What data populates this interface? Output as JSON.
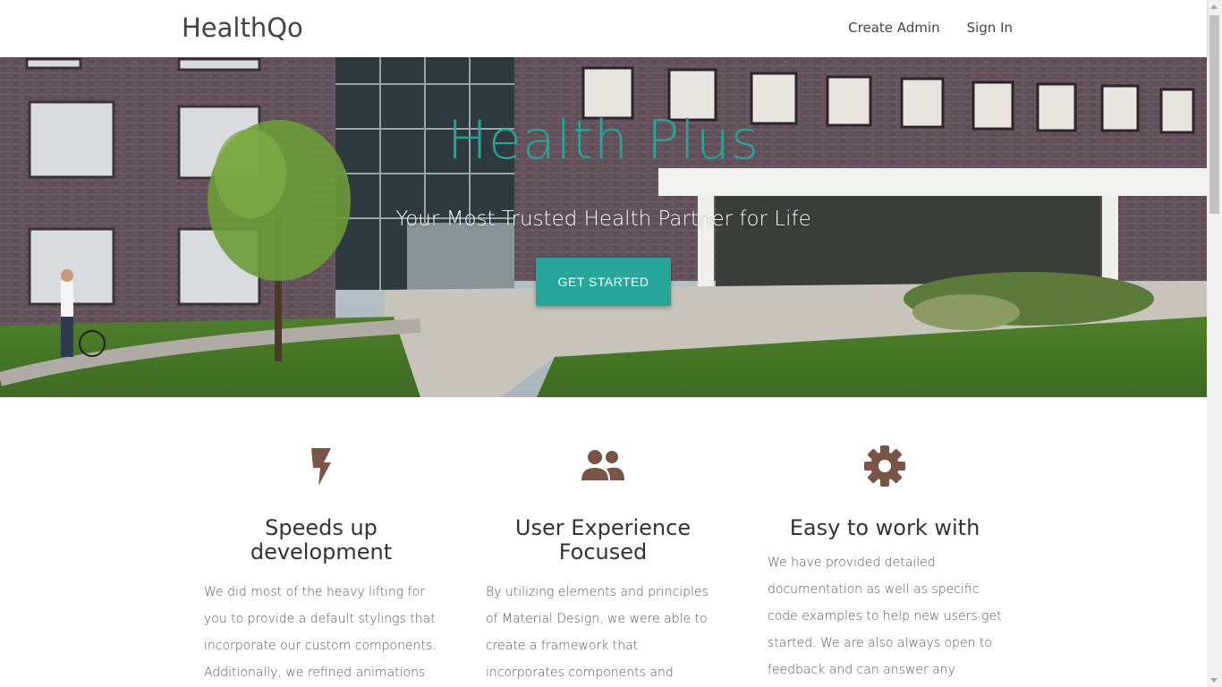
{
  "navbar": {
    "brand": "HealthQo",
    "links": [
      {
        "label": "Create Admin"
      },
      {
        "label": "Sign In"
      }
    ]
  },
  "hero": {
    "title": "Health Plus",
    "subtitle": "Your Most Trusted Health Partner for Life",
    "cta_label": "GET STARTED",
    "accent_color": "#26a69a"
  },
  "features": [
    {
      "icon": "flash-icon",
      "title": "Speeds up development",
      "text": "We did most of the heavy lifting for you to provide a default stylings that incorporate our custom components. Additionally, we refined animations and"
    },
    {
      "icon": "group-icon",
      "title": "User Experience Focused",
      "text": "By utilizing elements and principles of Material Design, we were able to create a framework that incorporates components and animations that provide more"
    },
    {
      "icon": "settings-icon",
      "title": "Easy to work with",
      "text": "We have provided detailed documentation as well as specific code examples to help new users get started. We are also always open to feedback and can answer any questions a user may"
    }
  ],
  "icon_color": "#795548"
}
